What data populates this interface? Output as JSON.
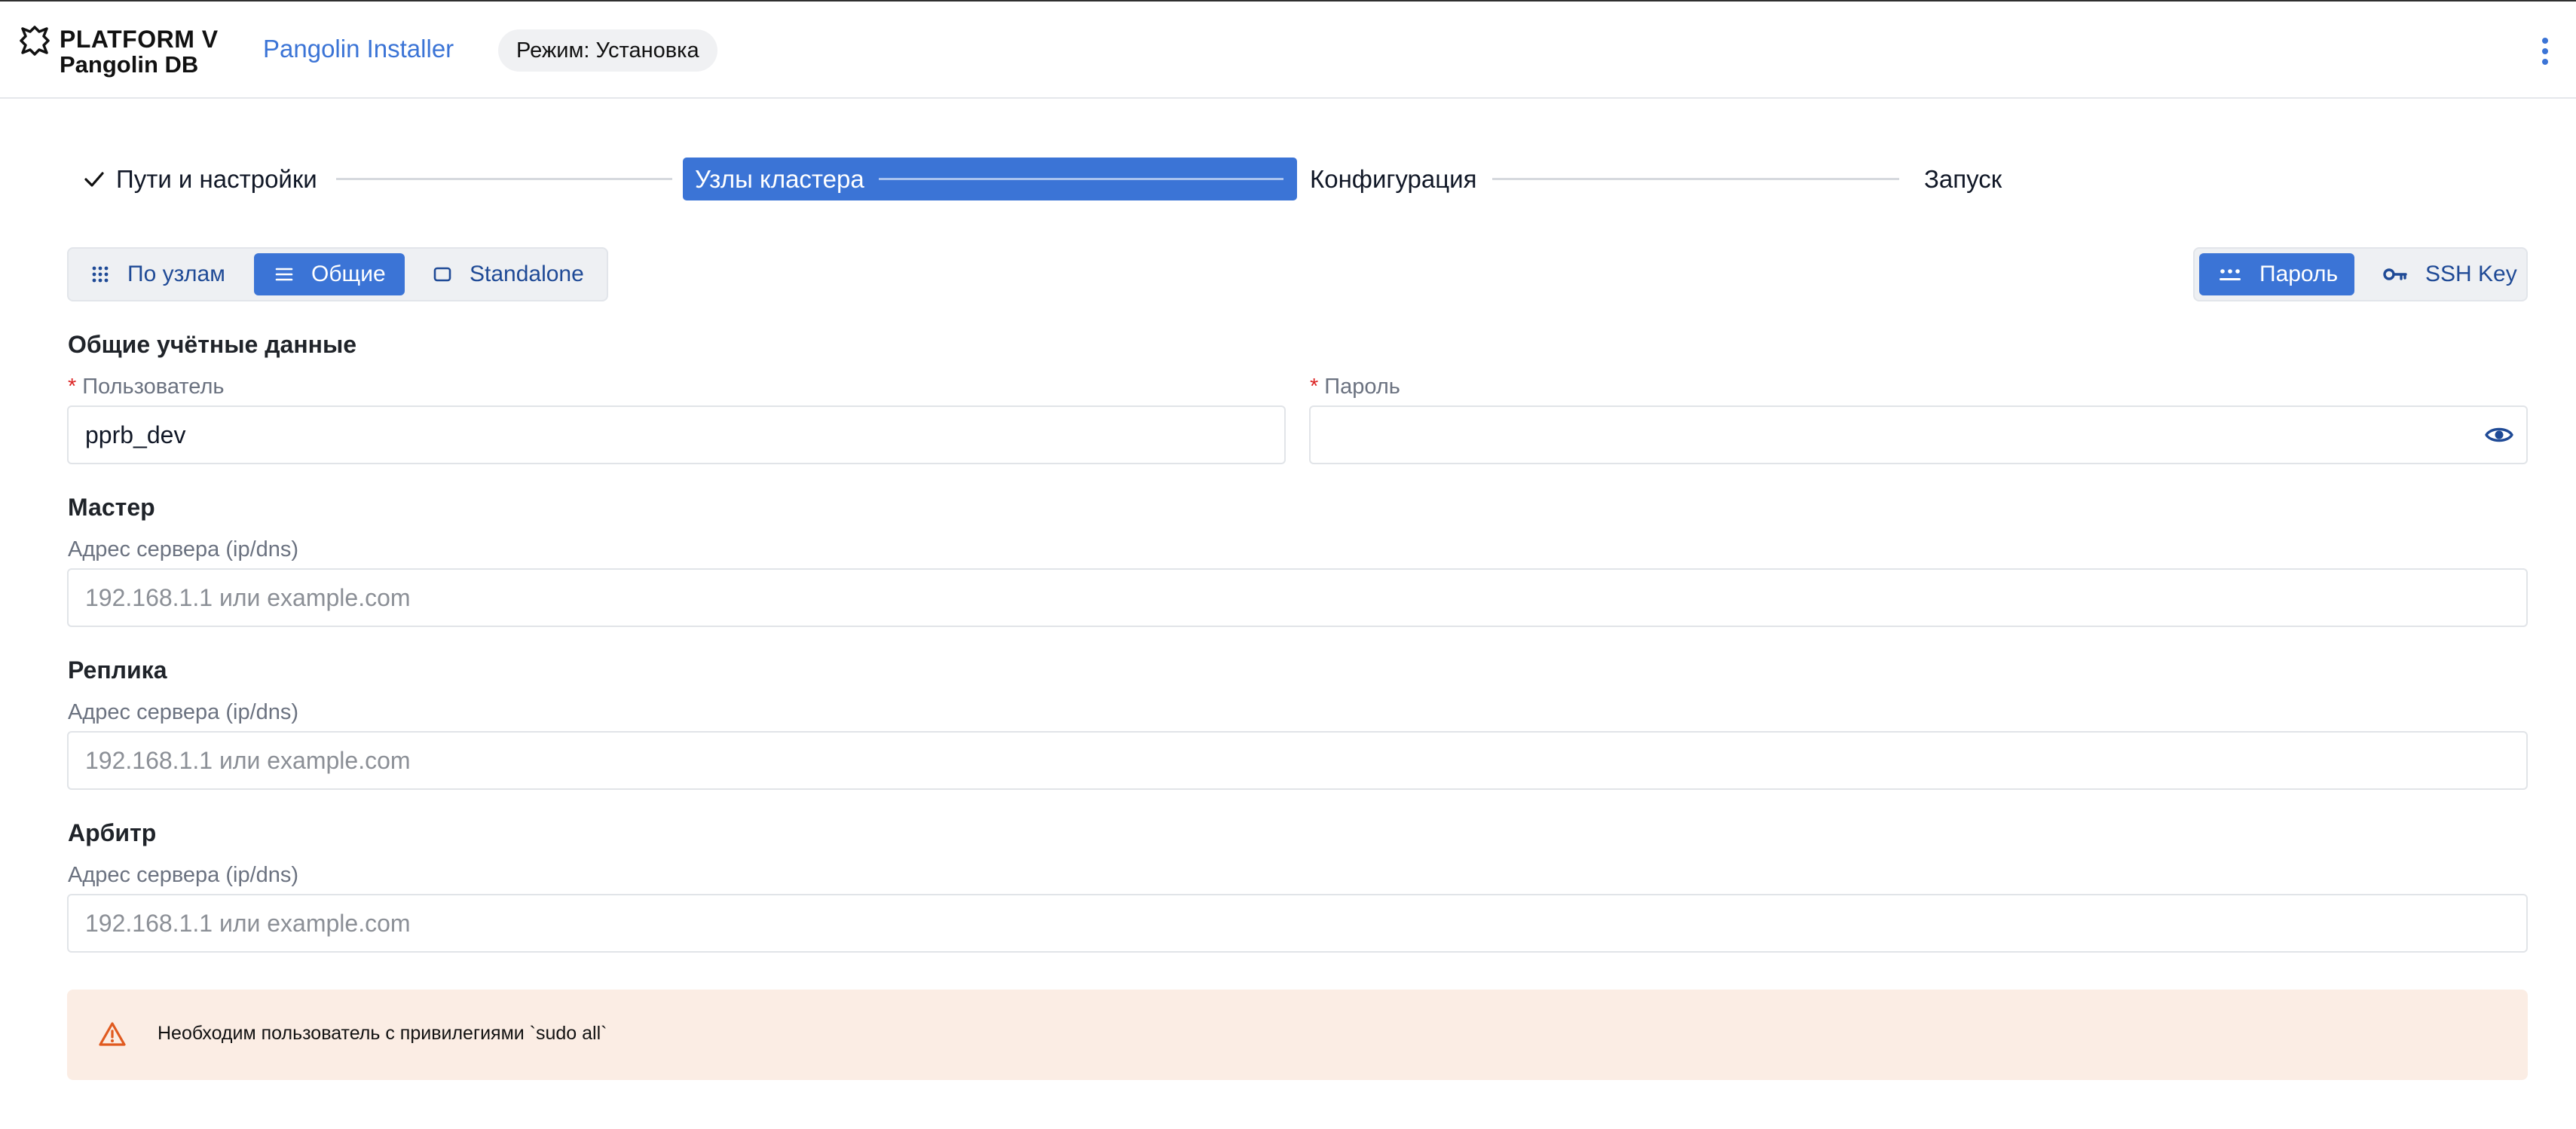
{
  "header": {
    "logo_line1": "PLATFORM V",
    "logo_line2": "Pangolin DB",
    "app_name": "Pangolin Installer",
    "mode_badge": "Режим: Установка",
    "menu_icon": "kebab-vertical-icon"
  },
  "stepper": {
    "steps": [
      {
        "label": "Пути и настройки",
        "state": "completed",
        "icon": "check-icon"
      },
      {
        "label": "Узлы кластера",
        "state": "active"
      },
      {
        "label": "Конфигурация",
        "state": "pending"
      },
      {
        "label": "Запуск",
        "state": "pending"
      }
    ]
  },
  "node_mode": {
    "selected": "Общие",
    "options": [
      {
        "label": "По узлам",
        "icon": "grid-dots-icon"
      },
      {
        "label": "Общие",
        "icon": "list-lines-icon"
      },
      {
        "label": "Standalone",
        "icon": "square-outline-icon"
      }
    ]
  },
  "auth_mode": {
    "selected": "Пароль",
    "options": [
      {
        "label": "Пароль",
        "icon": "password-dots-icon"
      },
      {
        "label": "SSH Key",
        "icon": "key-icon"
      }
    ]
  },
  "credentials": {
    "title": "Общие учётные данные",
    "required_mark": "*",
    "user_label": "Пользователь",
    "user_value": "pprb_dev",
    "password_label": "Пароль",
    "password_value": "",
    "password_icon": "eye-icon"
  },
  "nodes": [
    {
      "title": "Мастер",
      "label": "Адрес сервера (ip/dns)",
      "placeholder": "192.168.1.1 или example.com",
      "value": ""
    },
    {
      "title": "Реплика",
      "label": "Адрес сервера (ip/dns)",
      "placeholder": "192.168.1.1 или example.com",
      "value": ""
    },
    {
      "title": "Арбитр",
      "label": "Адрес сервера (ip/dns)",
      "placeholder": "192.168.1.1 или example.com",
      "value": ""
    }
  ],
  "alert": {
    "icon": "warning-triangle-icon",
    "text": "Необходим пользователь с привилегиями `sudo all`"
  },
  "colors": {
    "accent": "#3b74d6",
    "required": "#dc2626",
    "alert_background": "#fbede4",
    "alert_icon": "#e05a1f"
  }
}
